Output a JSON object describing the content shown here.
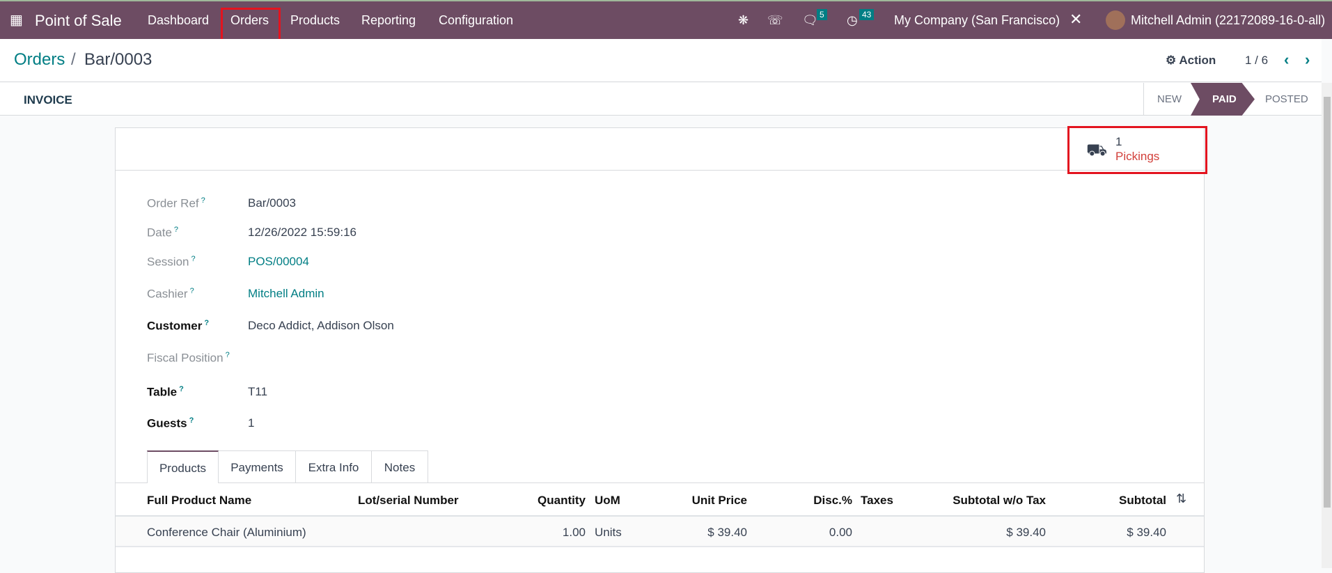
{
  "navbar": {
    "app_name": "Point of Sale",
    "menu": [
      "Dashboard",
      "Orders",
      "Products",
      "Reporting",
      "Configuration"
    ],
    "messages_count": "5",
    "activities_count": "43",
    "company": "My Company (San Francisco)",
    "user": "Mitchell Admin (22172089-16-0-all)"
  },
  "breadcrumb": {
    "parent": "Orders",
    "separator": "/",
    "current": "Bar/0003"
  },
  "control": {
    "action_label": "Action",
    "pager": "1 / 6"
  },
  "statusbar": {
    "invoice_button": "INVOICE",
    "stages": [
      "NEW",
      "PAID",
      "POSTED"
    ],
    "active_stage": "PAID"
  },
  "smart_button": {
    "count": "1",
    "label": "Pickings"
  },
  "fields": [
    {
      "label": "Order Ref",
      "value": "Bar/0003"
    },
    {
      "label": "Date",
      "value": "12/26/2022 15:59:16"
    },
    {
      "label": "Session",
      "value": "POS/00004"
    },
    {
      "label": "Cashier",
      "value": "Mitchell Admin"
    },
    {
      "label": "Customer",
      "value": "Deco Addict, Addison Olson"
    },
    {
      "label": "Fiscal Position",
      "value": ""
    },
    {
      "label": "Table",
      "value": "T11"
    },
    {
      "label": "Guests",
      "value": "1"
    }
  ],
  "help_mark": "?",
  "tabs": [
    "Products",
    "Payments",
    "Extra Info",
    "Notes"
  ],
  "table": {
    "headers": [
      "Full Product Name",
      "Lot/serial Number",
      "Quantity",
      "UoM",
      "Unit Price",
      "Disc.%",
      "Taxes",
      "Subtotal w/o Tax",
      "Subtotal"
    ],
    "rows": [
      [
        "Conference Chair (Aluminium)",
        "",
        "1.00",
        "Units",
        "$ 39.40",
        "0.00",
        "",
        "$ 39.40",
        "$ 39.40"
      ]
    ]
  },
  "colors": {
    "brand": "#6d4c63",
    "accent": "#017e84",
    "highlight": "#e3141f",
    "link_red": "#d23f3a"
  }
}
